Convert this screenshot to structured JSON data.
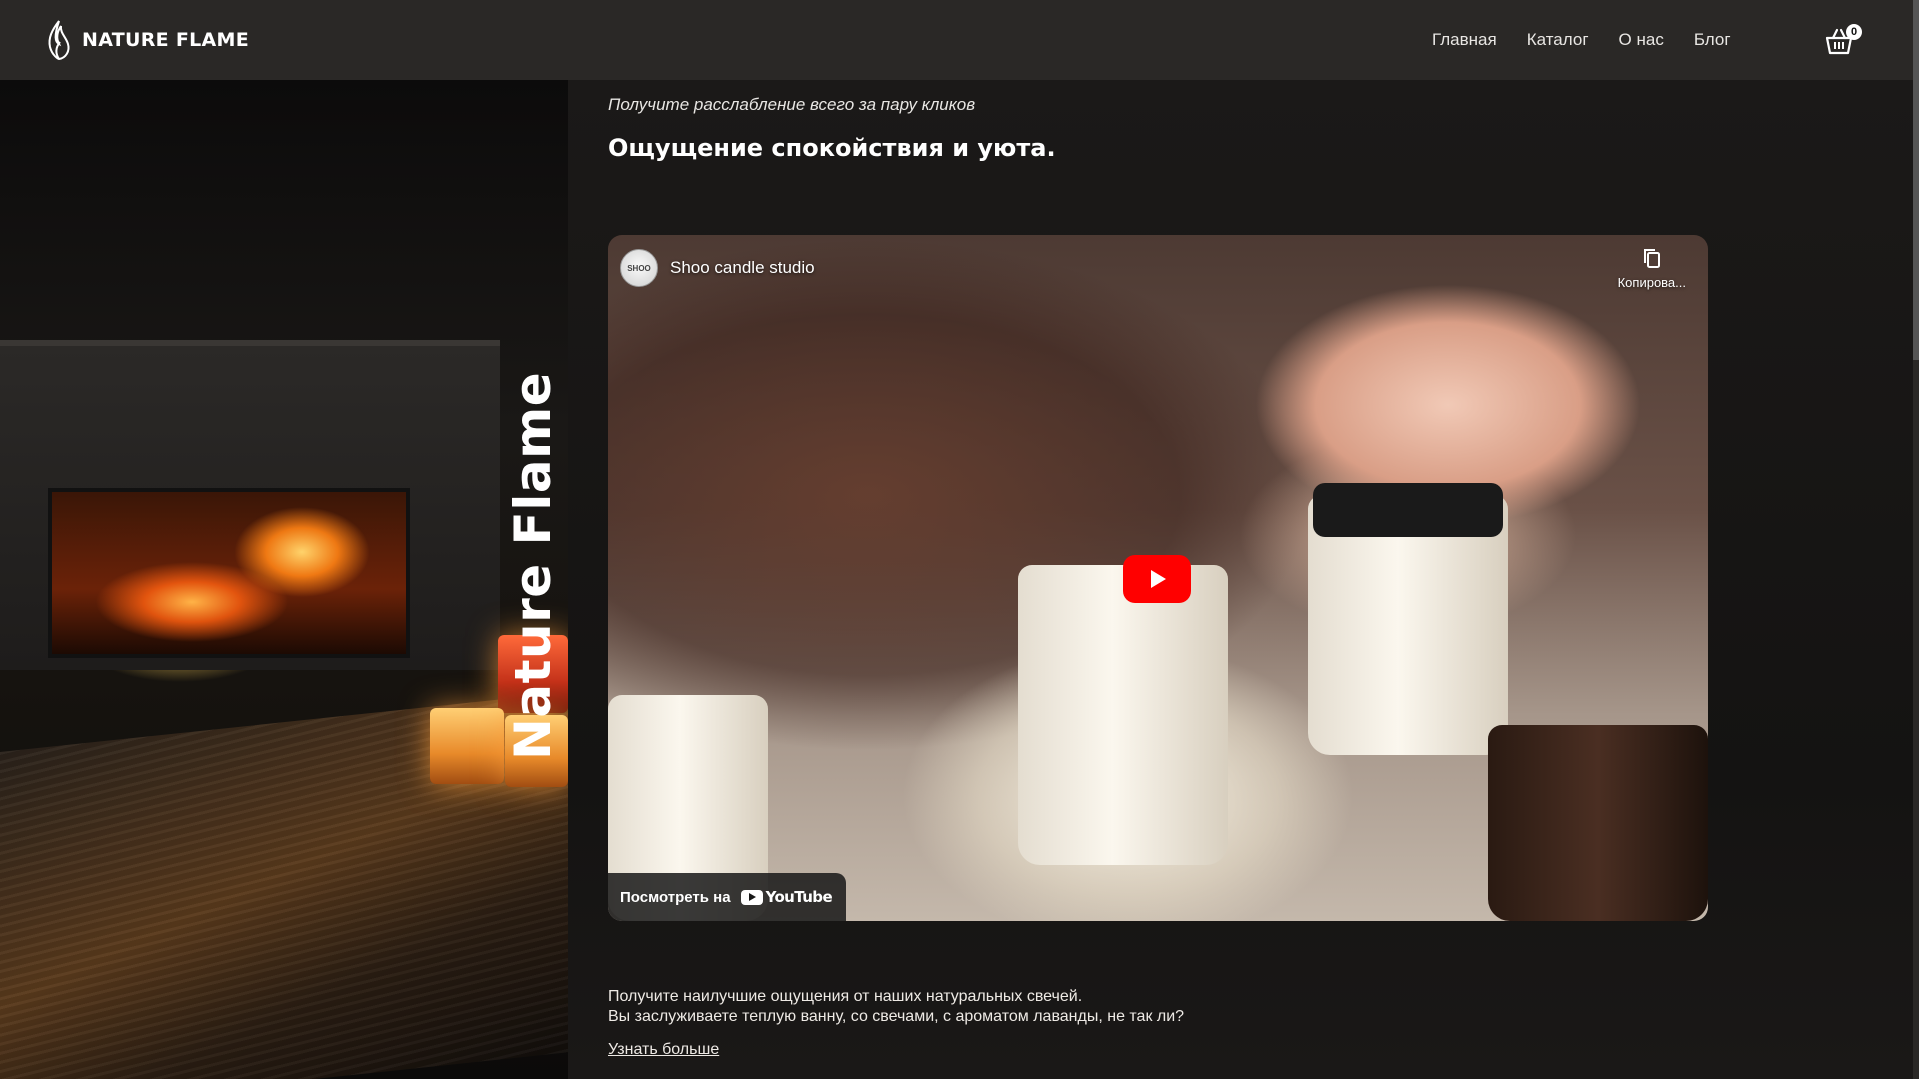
{
  "header": {
    "brand": "NATURE FLAME",
    "nav": [
      "Главная",
      "Каталог",
      "О нас",
      "Блог"
    ],
    "cart_count": "0"
  },
  "hero": {
    "vertical_title": "Nature Flame"
  },
  "main": {
    "subtitle": "Получите расслабление всего за пару кликов",
    "heading": "Ощущение спокойствия и уюта.",
    "video": {
      "channel_name": "Shoo candle studio",
      "channel_avatar_text": "SHOO",
      "copy_label": "Копирова...",
      "watch_on_label": "Посмотреть на",
      "youtube_word": "YouTube"
    },
    "description_line1": "Получите наилучшие ощущения от наших натуральных свечей.",
    "description_line2": "Вы заслуживаете теплую ванну, со свечами, с ароматом лаванды, не так ли?",
    "learn_more": "Узнать больше"
  },
  "colors": {
    "header_bg": "#2a2826",
    "page_bg": "#141313",
    "play_button": "#ff0000"
  },
  "icons": [
    "flame-logo-icon",
    "cart-icon",
    "copy-icon",
    "play-icon",
    "youtube-logo-icon"
  ]
}
